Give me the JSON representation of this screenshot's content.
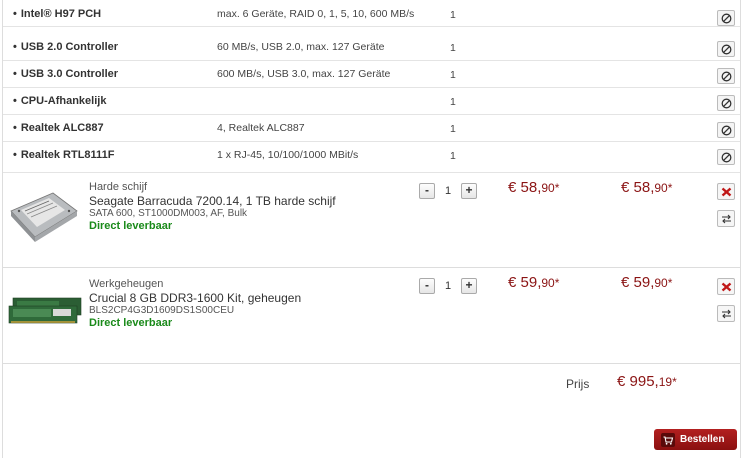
{
  "sub_components": [
    {
      "name": "Intel® H97 PCH",
      "spec": "max. 6 Geräte, RAID 0, 1, 5, 10, 600 MB/s",
      "qty": "1"
    },
    {
      "name": "USB 2.0 Controller",
      "spec": "60 MB/s, USB 2.0, max. 127 Geräte",
      "qty": "1"
    },
    {
      "name": "USB 3.0 Controller",
      "spec": "600 MB/s, USB 3.0, max. 127 Geräte",
      "qty": "1"
    },
    {
      "name": "CPU-Afhankelijk",
      "spec": "",
      "qty": "1"
    },
    {
      "name": "Realtek ALC887",
      "spec": "4, Realtek ALC887",
      "qty": "1"
    },
    {
      "name": "Realtek RTL8111F",
      "spec": "1 x RJ-45, 10/100/1000 MBit/s",
      "qty": "1"
    }
  ],
  "products": [
    {
      "category": "Harde schijf",
      "title": "Seagate Barracuda 7200.14, 1 TB harde schijf",
      "spec": "SATA 600, ST1000DM003, AF, Bulk",
      "availability": "Direct leverbaar",
      "qty": "1",
      "unit_price_main": "€ 58,",
      "unit_price_cents": "90*",
      "total_price_main": "€ 58,",
      "total_price_cents": "90*"
    },
    {
      "category": "Werkgeheugen",
      "title": "Crucial 8 GB DDR3-1600 Kit, geheugen",
      "spec": "BLS2CP4G3D1609DS1S00CEU",
      "availability": "Direct leverbaar",
      "qty": "1",
      "unit_price_main": "€ 59,",
      "unit_price_cents": "90*",
      "total_price_main": "€ 59,",
      "total_price_cents": "90*"
    }
  ],
  "stepper": {
    "minus": "-",
    "plus": "+"
  },
  "summary": {
    "label": "Prijs",
    "total_main": "€ 995,",
    "total_cents": "19*"
  },
  "order_button": {
    "label": "Bestellen"
  },
  "colors": {
    "price": "#8b1414",
    "available": "#1a8a1a",
    "button": "#a01818"
  }
}
